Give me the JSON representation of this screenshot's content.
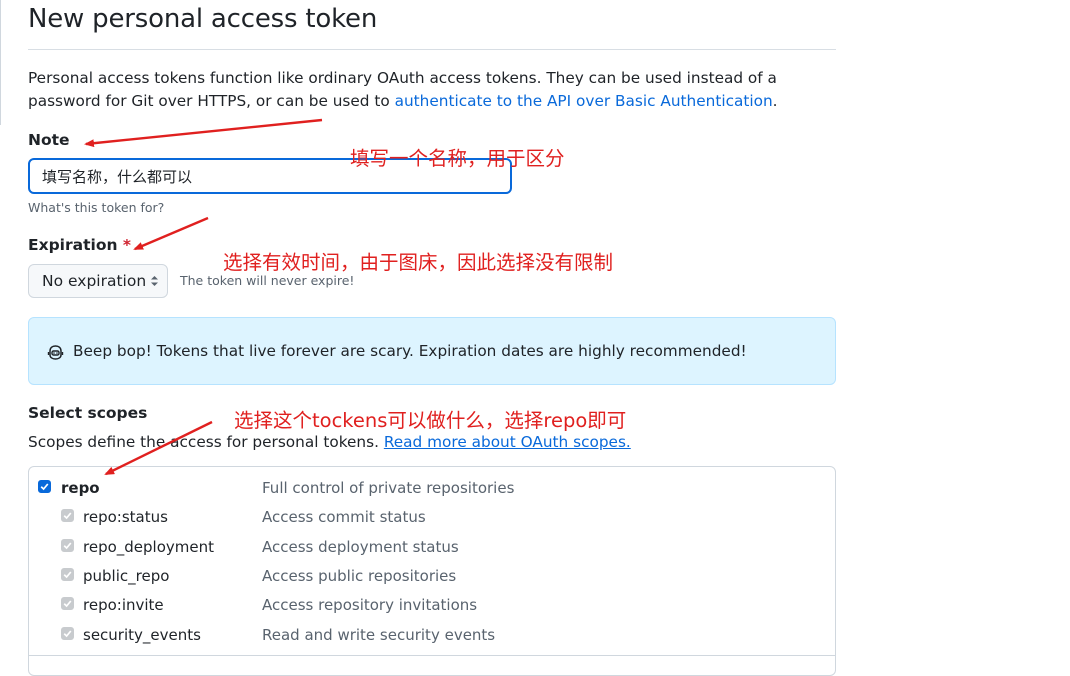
{
  "page": {
    "title": "New personal access token",
    "intro_text": "Personal access tokens function like ordinary OAuth access tokens. They can be used instead of a password for Git over HTTPS, or can be used to ",
    "intro_link": "authenticate to the API over Basic Authentication",
    "intro_end": "."
  },
  "note": {
    "label": "Note",
    "value": "填写名称，什么都可以",
    "hint": "What's this token for?"
  },
  "expiration": {
    "label": "Expiration",
    "required_mark": "*",
    "selected": "No expiration",
    "hint": "The token will never expire!"
  },
  "flash": {
    "icon": "copilot-bot-icon",
    "text": "Beep bop! Tokens that live forever are scary. Expiration dates are highly recommended!"
  },
  "scopes": {
    "heading": "Select scopes",
    "description": "Scopes define the access for personal tokens. ",
    "link": "Read more about OAuth scopes.",
    "main": {
      "name": "repo",
      "description": "Full control of private repositories",
      "checked": true
    },
    "children": [
      {
        "name": "repo:status",
        "description": "Access commit status"
      },
      {
        "name": "repo_deployment",
        "description": "Access deployment status"
      },
      {
        "name": "public_repo",
        "description": "Access public repositories"
      },
      {
        "name": "repo:invite",
        "description": "Access repository invitations"
      },
      {
        "name": "security_events",
        "description": "Read and write security events"
      }
    ]
  },
  "annotations": {
    "note": "填写一个名称，用于区分",
    "expiration": "选择有效时间，由于图床，因此选择没有限制",
    "scopes": "选择这个tockens可以做什么，选择repo即可",
    "color": "#e0201f"
  },
  "colors": {
    "link": "#0969da",
    "flash_bg": "#ddf4ff",
    "required": "#cf222e"
  }
}
